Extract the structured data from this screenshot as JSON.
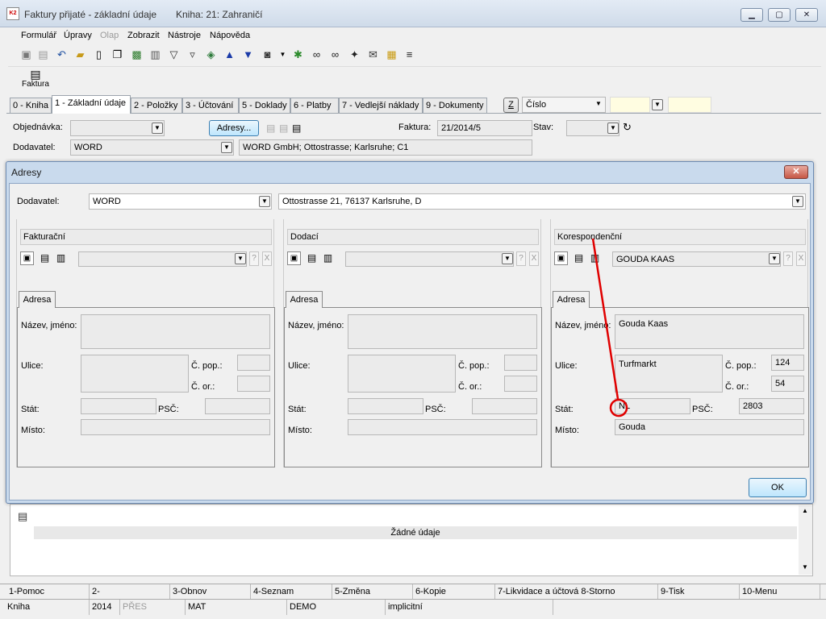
{
  "window": {
    "title": "Faktury přijaté - základní údaje",
    "book": "Kniha: 21: Zahraničí",
    "logo": "K2",
    "min_glyph": "▁",
    "max_glyph": "▢",
    "close_glyph": "✕"
  },
  "menu": [
    "Formulář",
    "Úpravy",
    "Olap",
    "Zobrazit",
    "Nástroje",
    "Nápověda"
  ],
  "toolbar_icons": [
    "save-icon",
    "save-all-icon",
    "undo-icon",
    "open-folder-icon",
    "new-document-icon",
    "copy-icon",
    "lock-icon",
    "book-icon",
    "filter-icon",
    "filter-list-icon",
    "stack-icon",
    "arrow-up-icon",
    "arrow-down-icon",
    "camera-icon",
    "dropdown-arrow-icon",
    "run-icon",
    "binoculars-icon",
    "binoculars-next-icon",
    "tools-icon",
    "mail-icon",
    "notes-icon",
    "list-icon"
  ],
  "ribbon": {
    "faktura": "Faktura"
  },
  "tabs": [
    "0 - Kniha",
    "1 - Základní údaje",
    "2 - Položky",
    "3 - Účtování",
    "5 - Doklady",
    "6 - Platby",
    "7 - Vedlejší náklady",
    "9 - Dokumenty"
  ],
  "tab_strip": {
    "z_button": "Z",
    "sort": "Číslo"
  },
  "form": {
    "objednavka_label": "Objednávka:",
    "objednavka_value": "",
    "adresy_button": "Adresy...",
    "faktura_label": "Faktura:",
    "faktura_value": "21/2014/5",
    "stav_label": "Stav:",
    "stav_value": "",
    "dodavatel_label": "Dodavatel:",
    "dodavatel_value": "WORD",
    "dodavatel_address": "WORD GmbH; Ottostrasse; Karlsruhe; C1"
  },
  "lower": {
    "no_data": "Žádné údaje"
  },
  "fkeys": [
    "1-Pomoc",
    "2-",
    "3-Obnov",
    "4-Seznam",
    "5-Změna",
    "6-Kopie",
    "7-Likvidace a účtová 8-Storno",
    "9-Tisk",
    "10-Menu"
  ],
  "status": [
    "Kniha",
    "2014",
    "PŘES",
    "MAT",
    "DEMO",
    "implicitní"
  ],
  "dialog": {
    "title": "Adresy",
    "dodavatel_label": "Dodavatel:",
    "dodavatel_value": "WORD",
    "dodavatel_address": "Ottostrasse 21, 76137 Karlsruhe, D",
    "ok": "OK",
    "field_labels": {
      "tab": "Adresa",
      "nazev": "Název, jméno:",
      "ulice": "Ulice:",
      "cpop": "Č. pop.:",
      "cor": "Č. or.:",
      "stat": "Stát:",
      "psc": "PSČ:",
      "misto": "Místo:"
    },
    "columns": [
      {
        "header": "Fakturační",
        "selector": "",
        "nazev": "",
        "ulice": "",
        "cpop": "",
        "cor": "",
        "stat": "",
        "psc": "",
        "misto": ""
      },
      {
        "header": "Dodací",
        "selector": "",
        "nazev": "",
        "ulice": "",
        "cpop": "",
        "cor": "",
        "stat": "",
        "psc": "",
        "misto": ""
      },
      {
        "header": "Korespondenční",
        "selector": "GOUDA KAAS",
        "nazev": "Gouda Kaas",
        "ulice": "Turfmarkt",
        "cpop": "124",
        "cor": "54",
        "stat": "NL",
        "psc": "2803",
        "misto": "Gouda"
      }
    ],
    "help_glyph": "?",
    "clear_glyph": "X"
  },
  "annotation_color": "#e00000"
}
